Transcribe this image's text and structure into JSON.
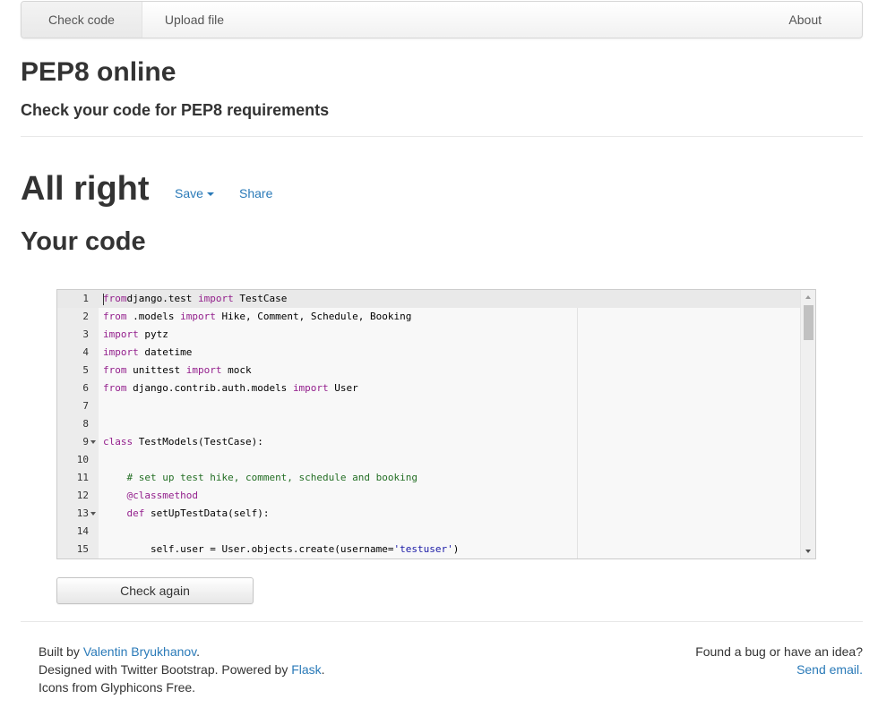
{
  "nav": {
    "check_code": "Check code",
    "upload_file": "Upload file",
    "about": "About"
  },
  "header": {
    "title": "PEP8 online",
    "subtitle": "Check your code for PEP8 requirements"
  },
  "result": {
    "title": "All right",
    "save_label": "Save",
    "share_label": "Share"
  },
  "code_section": {
    "title": "Your code"
  },
  "editor": {
    "lines": [
      {
        "num": "1",
        "tokens": [
          [
            "kw",
            "from"
          ],
          [
            "",
            "django.test "
          ],
          [
            "kw",
            "import"
          ],
          [
            "",
            " TestCase"
          ]
        ]
      },
      {
        "num": "2",
        "tokens": [
          [
            "kw",
            "from"
          ],
          [
            "",
            " .models "
          ],
          [
            "kw",
            "import"
          ],
          [
            "",
            " Hike, Comment, Schedule, Booking"
          ]
        ]
      },
      {
        "num": "3",
        "tokens": [
          [
            "kw",
            "import"
          ],
          [
            "",
            " pytz"
          ]
        ]
      },
      {
        "num": "4",
        "tokens": [
          [
            "kw",
            "import"
          ],
          [
            "",
            " datetime"
          ]
        ]
      },
      {
        "num": "5",
        "tokens": [
          [
            "kw",
            "from"
          ],
          [
            "",
            " unittest "
          ],
          [
            "kw",
            "import"
          ],
          [
            "",
            " mock"
          ]
        ]
      },
      {
        "num": "6",
        "tokens": [
          [
            "kw",
            "from"
          ],
          [
            "",
            " django.contrib.auth.models "
          ],
          [
            "kw",
            "import"
          ],
          [
            "",
            " User"
          ]
        ]
      },
      {
        "num": "7",
        "tokens": []
      },
      {
        "num": "8",
        "tokens": []
      },
      {
        "num": "9",
        "fold": true,
        "tokens": [
          [
            "kw",
            "class"
          ],
          [
            "",
            " TestModels(TestCase):"
          ]
        ]
      },
      {
        "num": "10",
        "tokens": []
      },
      {
        "num": "11",
        "tokens": [
          [
            "",
            "    "
          ],
          [
            "cm",
            "# set up test hike, comment, schedule and booking"
          ]
        ]
      },
      {
        "num": "12",
        "tokens": [
          [
            "",
            "    "
          ],
          [
            "kw",
            "@classmethod"
          ]
        ]
      },
      {
        "num": "13",
        "fold": true,
        "tokens": [
          [
            "",
            "    "
          ],
          [
            "kw",
            "def"
          ],
          [
            "",
            " setUpTestData(self):"
          ]
        ]
      },
      {
        "num": "14",
        "tokens": []
      },
      {
        "num": "15",
        "tokens": [
          [
            "",
            "        self.user = User.objects.create(username="
          ],
          [
            "st",
            "'testuser'"
          ],
          [
            "",
            ")"
          ]
        ]
      }
    ]
  },
  "check_again_label": "Check again",
  "footer": {
    "built_by_prefix": "Built by ",
    "author": "Valentin Bryukhanov",
    "built_by_suffix": ".",
    "designed_prefix": "Designed with Twitter Bootstrap. Powered by ",
    "flask": "Flask",
    "designed_suffix": ".",
    "icons": "Icons from Glyphicons Free.",
    "bug_text": "Found a bug or have an idea?",
    "send_email": "Send email."
  }
}
